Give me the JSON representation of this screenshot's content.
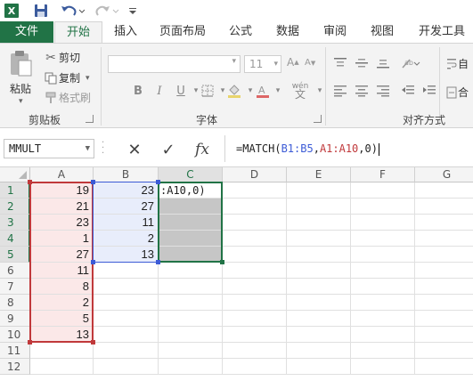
{
  "titlebar": {
    "app_icon_label": "X",
    "qat": [
      "save-icon",
      "undo-icon",
      "redo-icon",
      "customize-qat-icon"
    ]
  },
  "ribbon": {
    "tabs": [
      "文件",
      "开始",
      "插入",
      "页面布局",
      "公式",
      "数据",
      "审阅",
      "视图",
      "开发工具"
    ],
    "active_tab": "开始",
    "clipboard": {
      "paste_label": "粘贴",
      "cut_label": "剪切",
      "copy_label": "复制",
      "format_painter_label": "格式刷",
      "group_label": "剪贴板"
    },
    "font": {
      "font_name_value": "",
      "font_size_value": "11",
      "bold": "B",
      "italic": "I",
      "underline": "U",
      "phonetic": "wén",
      "group_label": "字体"
    },
    "alignment": {
      "wrap_label": "自",
      "merge_label": "合",
      "group_label": "对齐方式"
    }
  },
  "formula_bar": {
    "name_box": "MMULT",
    "cancel_icon": "✕",
    "enter_icon": "✓",
    "fx_label": "fx",
    "formula_parts": {
      "prefix": "=MATCH(",
      "ref1": "B1:B5",
      "sep1": ",",
      "ref2": "A1:A10",
      "suffix": ",0)"
    }
  },
  "sheet": {
    "columns": [
      "A",
      "B",
      "C",
      "D",
      "E",
      "F",
      "G"
    ],
    "selected_column": "C",
    "rows": [
      "1",
      "2",
      "3",
      "4",
      "5",
      "6",
      "7",
      "8",
      "9",
      "10",
      "11",
      "12"
    ],
    "col_a": [
      "19",
      "21",
      "23",
      "1",
      "27",
      "11",
      "8",
      "2",
      "5",
      "13"
    ],
    "col_b": [
      "23",
      "27",
      "11",
      "2",
      "13"
    ],
    "c1_edit": ":A10,0)"
  },
  "colors": {
    "accent": "#217346",
    "ref_blue": "#3c5bd6",
    "ref_red": "#c0393b",
    "selected_fill": "#c6c6c6"
  }
}
